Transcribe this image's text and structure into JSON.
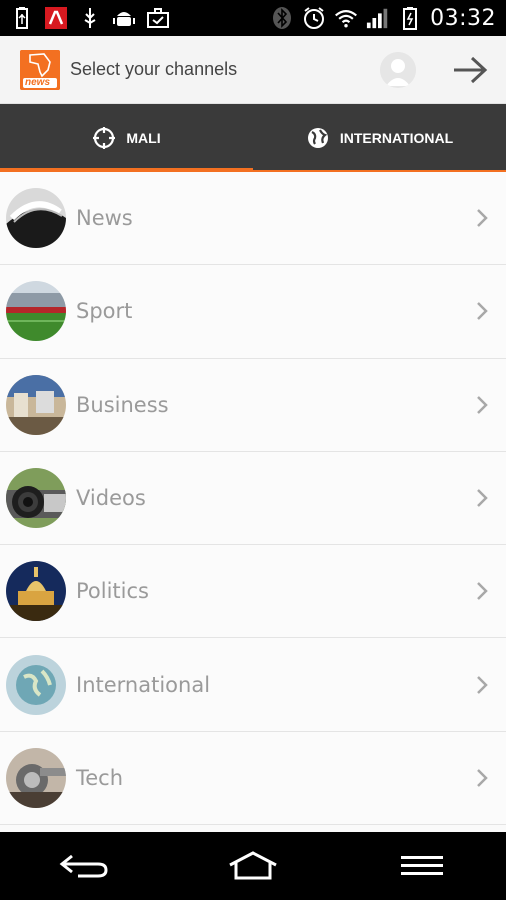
{
  "status_bar": {
    "time": "03:32",
    "icons": [
      "usb-icon",
      "avira-icon",
      "usb-debug-icon",
      "android-debug-icon",
      "briefcase-icon",
      "bluetooth-icon",
      "alarm-icon",
      "wifi-icon",
      "signal-icon",
      "battery-icon"
    ]
  },
  "app_bar": {
    "logo_text": "news",
    "title": "Select your channels"
  },
  "tabs": [
    {
      "label": "MALI",
      "icon": "crosshair-icon",
      "active": true
    },
    {
      "label": "INTERNATIONAL",
      "icon": "globe-icon",
      "active": false
    }
  ],
  "channels": [
    {
      "label": "News",
      "thumb": "newspaper"
    },
    {
      "label": "Sport",
      "thumb": "stadium"
    },
    {
      "label": "Business",
      "thumb": "office"
    },
    {
      "label": "Videos",
      "thumb": "camera-lens"
    },
    {
      "label": "Politics",
      "thumb": "capitol"
    },
    {
      "label": "International",
      "thumb": "globe"
    },
    {
      "label": "Tech",
      "thumb": "gears"
    }
  ],
  "colors": {
    "accent": "#f37021",
    "tab_bg": "#3a3a3a",
    "label": "#9a9a9a"
  }
}
